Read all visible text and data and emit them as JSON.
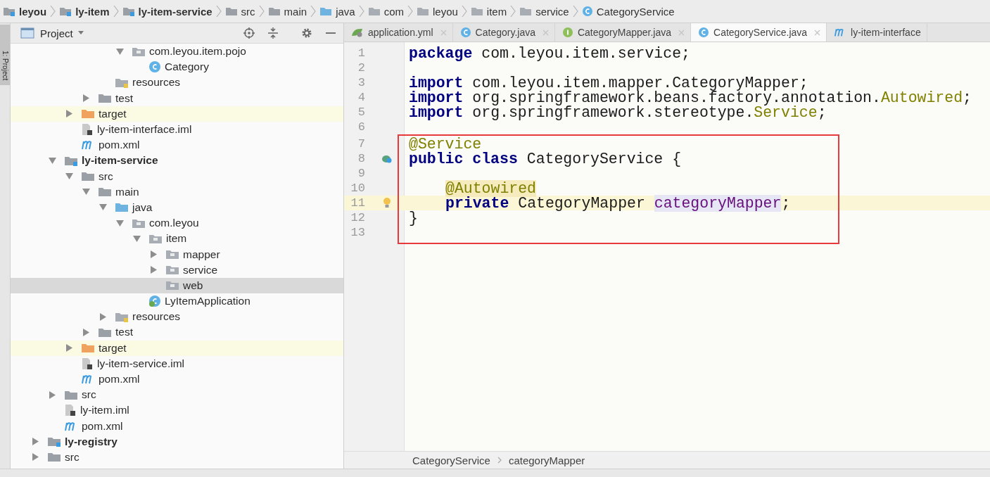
{
  "breadcrumb": [
    {
      "label": "leyou",
      "kind": "module"
    },
    {
      "label": "ly-item",
      "kind": "module"
    },
    {
      "label": "ly-item-service",
      "kind": "module"
    },
    {
      "label": "src",
      "kind": "folder"
    },
    {
      "label": "main",
      "kind": "folder"
    },
    {
      "label": "java",
      "kind": "source"
    },
    {
      "label": "com",
      "kind": "package"
    },
    {
      "label": "leyou",
      "kind": "package"
    },
    {
      "label": "item",
      "kind": "package"
    },
    {
      "label": "service",
      "kind": "package"
    },
    {
      "label": "CategoryService",
      "kind": "class"
    }
  ],
  "side_strip": {
    "label": "1: Project"
  },
  "project_panel": {
    "title": "Project",
    "tree": [
      {
        "children": [
          {
            "children": [
              {
                "children": [
                  {
                    "children": [
                      {
                        "children": [
                          {
                            "label": "com.leyou.item.pojo",
                            "kind": "package",
                            "expanded": true,
                            "selected": false,
                            "children": [
                              {
                                "label": "Category",
                                "kind": "class",
                                "selected": false
                              }
                            ]
                          }
                        ]
                      },
                      {
                        "label": "resources",
                        "kind": "resources",
                        "selected": false
                      }
                    ]
                  },
                  {
                    "label": "test",
                    "kind": "folder",
                    "expanded": false,
                    "selected": false
                  }
                ]
              },
              {
                "label": "target",
                "kind": "target",
                "expanded": false,
                "excluded": true,
                "selected": false
              },
              {
                "label": "ly-item-interface.iml",
                "kind": "iml",
                "selected": false
              },
              {
                "label": "pom.xml",
                "kind": "maven",
                "selected": false
              }
            ]
          },
          {
            "label": "ly-item-service",
            "kind": "module",
            "expanded": true,
            "selected": false,
            "children": [
              {
                "label": "src",
                "kind": "folder",
                "expanded": true,
                "selected": false,
                "children": [
                  {
                    "label": "main",
                    "kind": "folder",
                    "expanded": true,
                    "selected": false,
                    "children": [
                      {
                        "label": "java",
                        "kind": "source",
                        "expanded": true,
                        "selected": false,
                        "children": [
                          {
                            "label": "com.leyou",
                            "kind": "package",
                            "expanded": true,
                            "selected": false,
                            "children": [
                              {
                                "label": "item",
                                "kind": "package",
                                "expanded": true,
                                "selected": false,
                                "children": [
                                  {
                                    "label": "mapper",
                                    "kind": "package",
                                    "expanded": false,
                                    "selected": false
                                  },
                                  {
                                    "label": "service",
                                    "kind": "package",
                                    "expanded": false,
                                    "selected": false
                                  },
                                  {
                                    "label": "web",
                                    "kind": "package",
                                    "selected": true
                                  }
                                ]
                              },
                              {
                                "label": "LyItemApplication",
                                "kind": "app",
                                "selected": false
                              }
                            ]
                          }
                        ]
                      },
                      {
                        "label": "resources",
                        "kind": "resources",
                        "expanded": false,
                        "selected": false
                      }
                    ]
                  },
                  {
                    "label": "test",
                    "kind": "folder",
                    "expanded": false,
                    "selected": false
                  }
                ]
              },
              {
                "label": "target",
                "kind": "target",
                "expanded": false,
                "excluded": true,
                "selected": false
              },
              {
                "label": "ly-item-service.iml",
                "kind": "iml",
                "selected": false
              },
              {
                "label": "pom.xml",
                "kind": "maven",
                "selected": false
              }
            ]
          },
          {
            "label": "src",
            "kind": "folder",
            "expanded": false,
            "selected": false
          },
          {
            "label": "ly-item.iml",
            "kind": "iml",
            "selected": false
          },
          {
            "label": "pom.xml",
            "kind": "maven",
            "selected": false
          }
        ]
      },
      {
        "label": "ly-registry",
        "kind": "module",
        "expanded": false,
        "selected": false
      },
      {
        "label": "src",
        "kind": "folder",
        "expanded": false,
        "selected": false
      }
    ]
  },
  "editor_tabs": [
    {
      "label": "application.yml",
      "kind": "yaml",
      "selected": false,
      "closable": true
    },
    {
      "label": "Category.java",
      "kind": "class",
      "selected": false,
      "closable": true
    },
    {
      "label": "CategoryMapper.java",
      "kind": "interface",
      "selected": false,
      "closable": true
    },
    {
      "label": "CategoryService.java",
      "kind": "class",
      "selected": true,
      "closable": true
    },
    {
      "label": "ly-item-interface",
      "kind": "maven",
      "selected": false,
      "closable": false
    }
  ],
  "code_blocks": [
    {
      "lines": [
        {
          "number": "1",
          "tokens": [
            {
              "text": "package",
              "kind": "keyword"
            },
            {
              "text": " com.leyou.item.service;",
              "kind": "plain"
            }
          ]
        },
        {
          "number": "2"
        },
        {
          "number": "3",
          "tokens": [
            {
              "text": "import",
              "kind": "keyword"
            },
            {
              "text": " com.leyou.item.mapper.CategoryMapper;",
              "kind": "plain"
            }
          ]
        },
        {
          "number": "4",
          "tokens": [
            {
              "text": "import",
              "kind": "keyword"
            },
            {
              "text": " org.springframework.beans.factory.annotation.",
              "kind": "plain"
            },
            {
              "text": "Autowired",
              "kind": "annotation"
            },
            {
              "text": ";",
              "kind": "plain"
            }
          ]
        },
        {
          "number": "5",
          "tokens": [
            {
              "text": "import",
              "kind": "keyword"
            },
            {
              "text": " org.springframework.stereotype.",
              "kind": "plain"
            },
            {
              "text": "Service",
              "kind": "annotation"
            },
            {
              "text": ";",
              "kind": "plain"
            }
          ]
        },
        {
          "number": "6"
        }
      ]
    },
    {
      "boxed": true,
      "lines": [
        {
          "number": "7",
          "tokens": [
            {
              "text": "@Service",
              "kind": "annotation"
            }
          ]
        },
        {
          "number": "8",
          "gutter": {
            "kind": "bean"
          },
          "tokens": [
            {
              "text": "public class",
              "kind": "keyword"
            },
            {
              "text": " CategoryService {",
              "kind": "plain"
            }
          ]
        },
        {
          "number": "9"
        },
        {
          "number": "10",
          "indented": true,
          "tokens": [
            {
              "text": "@Autowired",
              "kind": "warning"
            }
          ]
        },
        {
          "number": "11",
          "current": true,
          "indented": true,
          "gutter": {
            "kind": "bulb"
          },
          "tokens": [
            {
              "text": "private",
              "kind": "keyword"
            },
            {
              "text": " CategoryMapper ",
              "kind": "plain"
            },
            {
              "text": "categoryMapper",
              "kind": "field"
            },
            {
              "text": ";",
              "kind": "plain"
            }
          ]
        },
        {
          "number": "12",
          "tokens": [
            {
              "text": "}",
              "kind": "plain"
            }
          ]
        },
        {
          "number": "13"
        }
      ]
    }
  ],
  "editor_breadcrumb": [
    "CategoryService",
    "categoryMapper"
  ]
}
